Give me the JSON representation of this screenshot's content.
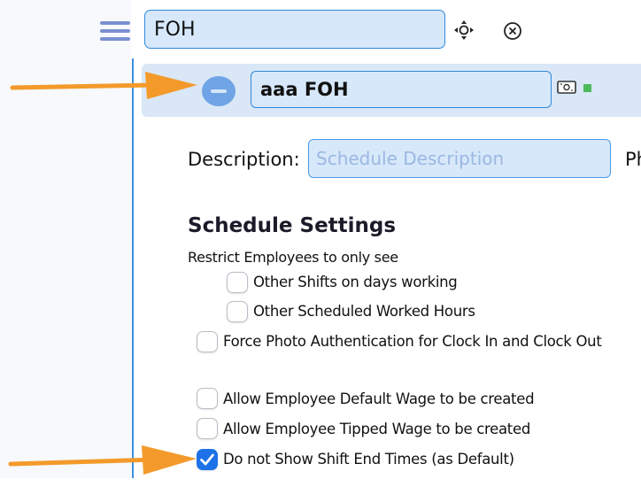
{
  "toolbar": {
    "group_name": "FOH"
  },
  "schedule": {
    "name": "aaa FOH"
  },
  "form": {
    "description_label": "Description:",
    "description_placeholder": "Schedule Description",
    "next_label_partial": "Ph"
  },
  "settings": {
    "title": "Schedule Settings",
    "restrict_label": "Restrict Employees to only see",
    "options": [
      {
        "label": "Other Shifts on days working",
        "checked": false
      },
      {
        "label": "Other Scheduled Worked Hours",
        "checked": false
      },
      {
        "label": "Force Photo Authentication for Clock In and Clock Out",
        "checked": false
      },
      {
        "label": "Allow Employee Default Wage to be created",
        "checked": false
      },
      {
        "label": "Allow Employee Tipped Wage to be created",
        "checked": false
      },
      {
        "label": "Do not Show Shift End Times (as Default)",
        "checked": true
      }
    ]
  },
  "colors": {
    "accent": "#2f89d9",
    "input_bg": "#d7e8fb",
    "header_bg": "#d9e7f6",
    "arrow": "#f39a2b",
    "checked": "#1d72e8",
    "status_green": "#4cbb5a"
  }
}
